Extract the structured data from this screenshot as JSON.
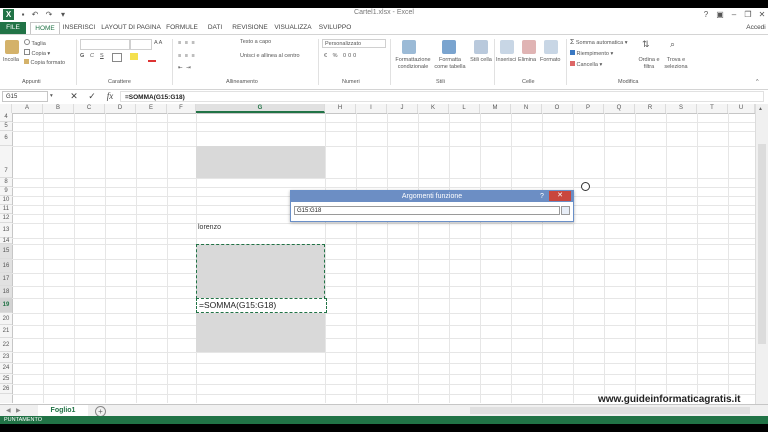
{
  "window": {
    "title": "Cartel1.xlsx - Excel",
    "account": "Accedi"
  },
  "tabs": [
    "FILE",
    "HOME",
    "INSERISCI",
    "LAYOUT DI PAGINA",
    "FORMULE",
    "DATI",
    "REVISIONE",
    "VISUALIZZA",
    "SVILUPPO"
  ],
  "ribbon": {
    "clipboard": {
      "paste": "Incolla",
      "cut": "Taglia",
      "copy": "Copia",
      "format_painter": "Copia formato",
      "group": "Appunti"
    },
    "font": {
      "group": "Carattere"
    },
    "alignment": {
      "wrap": "Testo a capo",
      "merge": "Unisci e allinea al centro",
      "group": "Allineamento"
    },
    "number": {
      "format": "Personalizzato",
      "group": "Numeri"
    },
    "styles": {
      "conditional": "Formattazione condizionale",
      "table": "Formatta come tabella",
      "cell_styles": "Stili cella",
      "group": "Stili"
    },
    "cells": {
      "insert": "Inserisci",
      "delete": "Elimina",
      "format": "Formato",
      "group": "Celle"
    },
    "editing": {
      "autosum": "Somma automatica",
      "fill": "Riempimento",
      "clear": "Cancella",
      "sort": "Ordina e filtra",
      "find": "Trova e seleziona",
      "group": "Modifica"
    }
  },
  "formula_bar": {
    "name_box": "G15",
    "fx": "fx",
    "formula": "=SOMMA(G15:G18)"
  },
  "columns": [
    "A",
    "B",
    "C",
    "D",
    "E",
    "F",
    "G",
    "H",
    "I",
    "J",
    "K",
    "L",
    "M",
    "N",
    "O",
    "P",
    "Q",
    "R",
    "S",
    "T",
    "U",
    "V"
  ],
  "rows": [
    "4",
    "5",
    "6",
    "7",
    "8",
    "9",
    "10",
    "11",
    "12",
    "13",
    "14",
    "15",
    "16",
    "17",
    "18",
    "19",
    "20",
    "21",
    "22",
    "23",
    "24",
    "25",
    "26"
  ],
  "cells": {
    "g12": "lorenzo",
    "g19": "=SOMMA(G15:G18)"
  },
  "dialog": {
    "title": "Argomenti funzione",
    "help": "?",
    "close": "✕",
    "ref": "G15:G18"
  },
  "sheet": {
    "name": "Foglio1",
    "add": "+"
  },
  "status": {
    "mode": "PUNTAMENTO"
  },
  "watermark": "www.guideinformaticagratis.it"
}
